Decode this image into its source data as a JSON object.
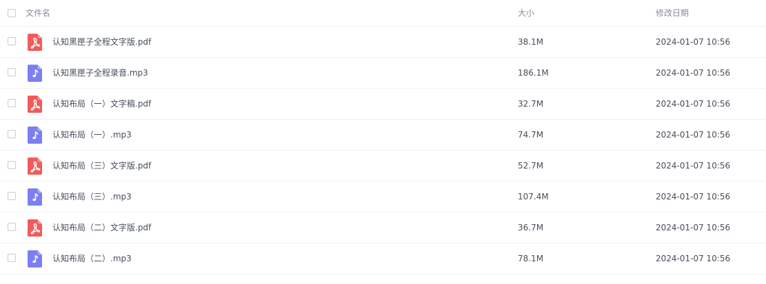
{
  "header": {
    "name": "文件名",
    "size": "大小",
    "modified": "修改日期"
  },
  "colors": {
    "pdf": "#f15b5b",
    "audio": "#7c7ff0"
  },
  "files": [
    {
      "name": "认知黑匣子全程文字版.pdf",
      "size": "38.1M",
      "date": "2024-01-07 10:56",
      "type": "pdf",
      "icon": "pdf-icon"
    },
    {
      "name": "认知黑匣子全程录音.mp3",
      "size": "186.1M",
      "date": "2024-01-07 10:56",
      "type": "audio",
      "icon": "music-note-icon"
    },
    {
      "name": "认知布局（一）文字稿.pdf",
      "size": "32.7M",
      "date": "2024-01-07 10:56",
      "type": "pdf",
      "icon": "pdf-icon"
    },
    {
      "name": "认知布局（一）.mp3",
      "size": "74.7M",
      "date": "2024-01-07 10:56",
      "type": "audio",
      "icon": "music-note-icon"
    },
    {
      "name": "认知布局（三）文字版.pdf",
      "size": "52.7M",
      "date": "2024-01-07 10:56",
      "type": "pdf",
      "icon": "pdf-icon"
    },
    {
      "name": "认知布局（三）.mp3",
      "size": "107.4M",
      "date": "2024-01-07 10:56",
      "type": "audio",
      "icon": "music-note-icon"
    },
    {
      "name": "认知布局（二）文字版.pdf",
      "size": "36.7M",
      "date": "2024-01-07 10:56",
      "type": "pdf",
      "icon": "pdf-icon"
    },
    {
      "name": "认知布局（二）.mp3",
      "size": "78.1M",
      "date": "2024-01-07 10:56",
      "type": "audio",
      "icon": "music-note-icon"
    }
  ]
}
